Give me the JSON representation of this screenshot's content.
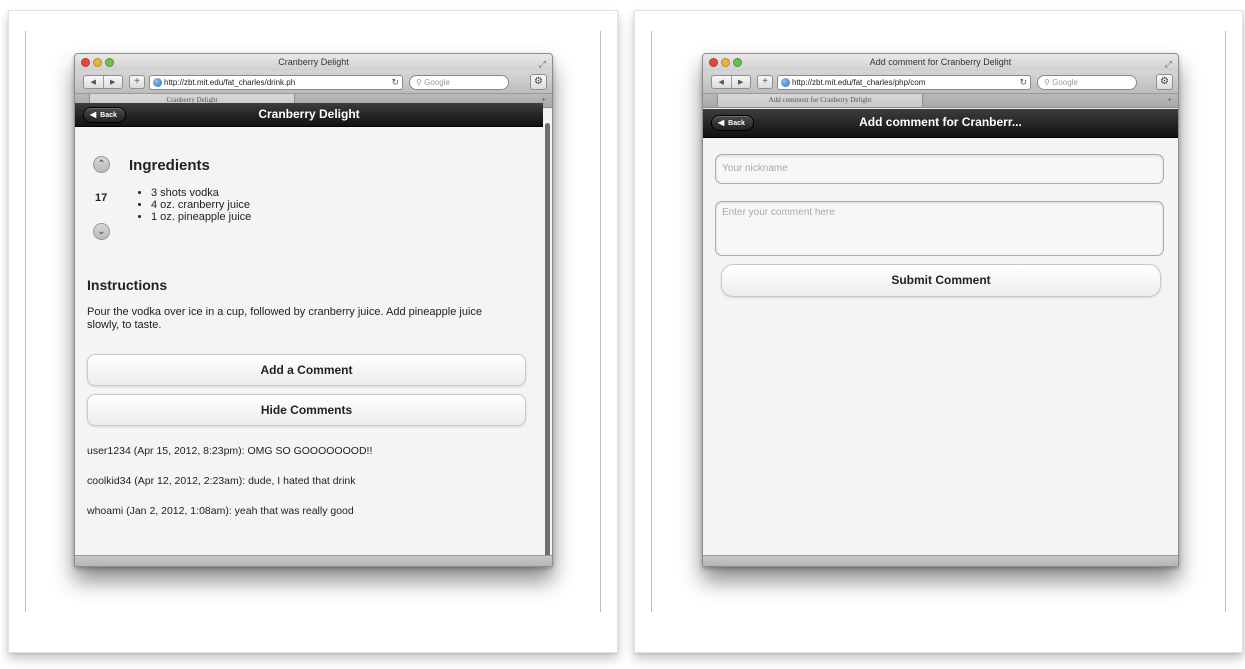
{
  "left": {
    "window_title": "Cranberry Delight",
    "url": "http://zbt.mit.edu/fat_charles/drink.ph",
    "search_placeholder": "Google",
    "tab_label": "Cranberry Delight",
    "nav_back_glyph": "◀",
    "nav_forward_glyph": "▶",
    "back_label": "Back",
    "page_title": "Cranberry Delight",
    "ingredients_heading": "Ingredients",
    "vote_count": "17",
    "ingredients": [
      "3 shots vodka",
      "4 oz. cranberry juice",
      "1 oz. pineapple juice"
    ],
    "instructions_heading": "Instructions",
    "instructions_text": "Pour the vodka over ice in a cup, followed by cranberry juice. Add pineapple juice slowly, to taste.",
    "add_comment_label": "Add a Comment",
    "hide_comments_label": "Hide Comments",
    "comments": [
      "user1234 (Apr 15, 2012, 8:23pm): OMG SO GOOOOOOOD!!",
      "coolkid34 (Apr 12, 2012, 2:23am): dude, I hated that drink",
      "whoami (Jan 2, 2012, 1:08am): yeah that was really good"
    ]
  },
  "right": {
    "window_title": "Add comment for Cranberry Delight",
    "url": "http://zbt.mit.edu/fat_charles/php/com",
    "search_placeholder": "Google",
    "tab_label": "Add comment for Cranberry Delight",
    "back_label": "Back",
    "page_title": "Add comment for Cranberr...",
    "nickname_placeholder": "Your nickname",
    "comment_placeholder": "Enter your comment here",
    "submit_label": "Submit Comment"
  },
  "icons": {
    "up_vote": "up-chevron-icon",
    "down_vote": "down-chevron-icon",
    "globe": "globe-icon",
    "reload": "reload-icon",
    "gear": "gear-icon"
  },
  "colors": {
    "header_bg": "#1a1a1a",
    "content_bg": "#f4f4f4",
    "button_bg": "#ffffff"
  }
}
